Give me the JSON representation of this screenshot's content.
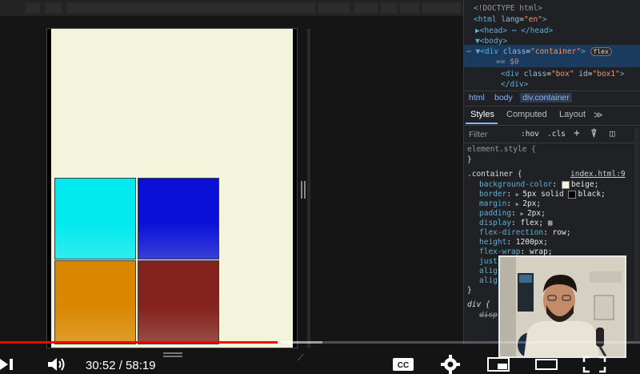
{
  "devtools": {
    "dom_lines": [
      {
        "text": "<!DOCTYPE html>"
      },
      {
        "open": "<html ",
        "attr": "lang",
        "val": "\"en\"",
        "close": ">"
      },
      {
        "text": "▶<head> ⋯ </head>"
      },
      {
        "text": "▼<body>"
      },
      {
        "open": "▼<div ",
        "attr": "class",
        "val": "\"container\"",
        "close": ">",
        "badge": "flex"
      },
      {
        "text": "== $0"
      },
      {
        "open": "<div ",
        "attr": "class",
        "val": "\"box\"",
        "attr2": "id",
        "val2": "\"box1\"",
        "close": ">"
      },
      {
        "text": "</div>"
      }
    ],
    "breadcrumbs": [
      "html",
      "body",
      "div.container"
    ],
    "tabs": [
      "Styles",
      "Computed",
      "Layout",
      "≫"
    ],
    "filter": {
      "placeholder": "Filter",
      "hov": ":hov",
      "cls": ".cls"
    },
    "rules": {
      "element_style": "element.style {",
      "element_close": "}",
      "container_selector": ".container {",
      "container_source": "index.html:9",
      "container_props": [
        {
          "name": "background-color",
          "value": "beige;",
          "swatch": "#f5f5dc"
        },
        {
          "name": "border",
          "value": "5px solid",
          "value2": "black;",
          "swatch2": "#000000",
          "tri": true
        },
        {
          "name": "margin",
          "value": "2px;",
          "tri": true
        },
        {
          "name": "padding",
          "value": "2px;",
          "tri": true
        },
        {
          "name": "display",
          "value": "flex;",
          "grid": true
        },
        {
          "name": "flex-direction",
          "value": "row;"
        },
        {
          "name": "height",
          "value": "1200px;"
        },
        {
          "name": "flex-wrap",
          "value": "wrap;"
        },
        {
          "name": "just",
          "value": ""
        },
        {
          "name": "alig",
          "value": ""
        },
        {
          "name": "alig",
          "value": ""
        }
      ],
      "container_close": "}",
      "div_selector": "div {",
      "div_partial": "disp"
    }
  },
  "boxes": [
    {
      "id": "box1",
      "color": "#00eaf0"
    },
    {
      "id": "box2",
      "color": "#0a10d8"
    },
    {
      "id": "box3",
      "color": "#d98700"
    },
    {
      "id": "box4",
      "color": "#84221f"
    }
  ],
  "player": {
    "time": "30:52 / 58:19",
    "progress_fraction": 0.434,
    "buffer_fraction": 0.504,
    "icons": [
      "next-icon",
      "volume-icon",
      "cc-icon",
      "settings-icon",
      "miniplayer-icon",
      "theater-icon",
      "fullscreen-icon"
    ]
  },
  "cc_label": "CC"
}
